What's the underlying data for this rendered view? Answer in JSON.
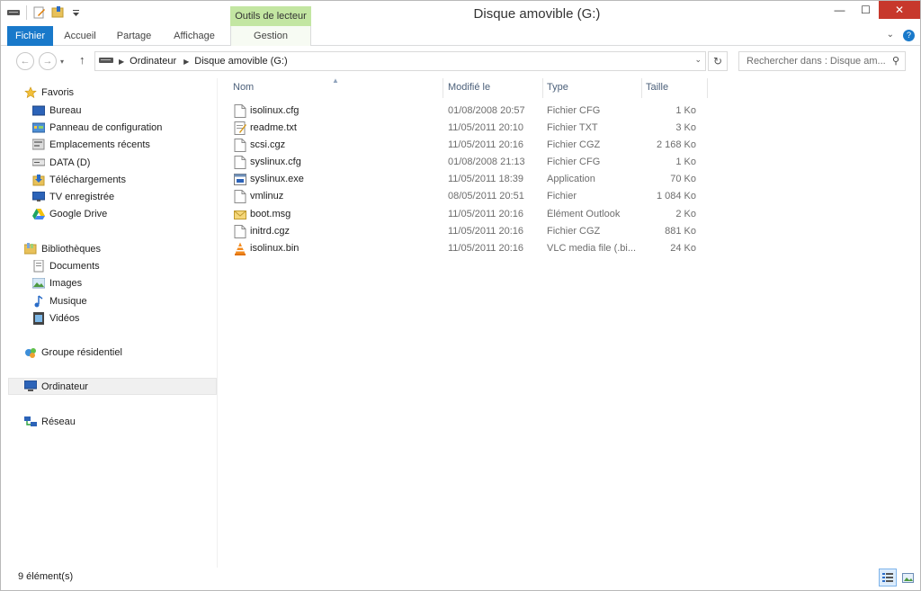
{
  "window": {
    "title": "Disque amovible (G:)",
    "contextual_tab": "Outils de lecteur",
    "controls": {
      "minimize": "—",
      "maximize": "☐",
      "close": "✕"
    }
  },
  "ribbon": {
    "tabs": [
      {
        "label": "Fichier"
      },
      {
        "label": "Accueil"
      },
      {
        "label": "Partage"
      },
      {
        "label": "Affichage"
      },
      {
        "label": "Gestion"
      }
    ],
    "expand_glyph": "⌄",
    "help_glyph": "?"
  },
  "address": {
    "segments": [
      "Ordinateur",
      "Disque amovible (G:)"
    ],
    "search_placeholder": "Rechercher dans : Disque am..."
  },
  "navpane": {
    "favorites": {
      "label": "Favoris",
      "items": [
        "Bureau",
        "Panneau de configuration",
        "Emplacements récents",
        "DATA (D)",
        "Téléchargements",
        "TV enregistrée",
        "Google Drive"
      ]
    },
    "libraries": {
      "label": "Bibliothèques",
      "items": [
        "Documents",
        "Images",
        "Musique",
        "Vidéos"
      ]
    },
    "homegroup": "Groupe résidentiel",
    "computer": "Ordinateur",
    "network": "Réseau"
  },
  "columns": {
    "name": "Nom",
    "modified": "Modifié le",
    "type": "Type",
    "size": "Taille"
  },
  "files": [
    {
      "name": "isolinux.cfg",
      "modified": "01/08/2008 20:57",
      "type": "Fichier CFG",
      "size": "1 Ko",
      "icon": "file-icon"
    },
    {
      "name": "readme.txt",
      "modified": "11/05/2011 20:10",
      "type": "Fichier TXT",
      "size": "3 Ko",
      "icon": "text-file-icon"
    },
    {
      "name": "scsi.cgz",
      "modified": "11/05/2011 20:16",
      "type": "Fichier CGZ",
      "size": "2 168 Ko",
      "icon": "file-icon"
    },
    {
      "name": "syslinux.cfg",
      "modified": "01/08/2008 21:13",
      "type": "Fichier CFG",
      "size": "1 Ko",
      "icon": "file-icon"
    },
    {
      "name": "syslinux.exe",
      "modified": "11/05/2011 18:39",
      "type": "Application",
      "size": "70 Ko",
      "icon": "exe-icon"
    },
    {
      "name": "vmlinuz",
      "modified": "08/05/2011 20:51",
      "type": "Fichier",
      "size": "1 084 Ko",
      "icon": "file-icon"
    },
    {
      "name": "boot.msg",
      "modified": "11/05/2011 20:16",
      "type": "Élément Outlook",
      "size": "2 Ko",
      "icon": "mail-icon"
    },
    {
      "name": "initrd.cgz",
      "modified": "11/05/2011 20:16",
      "type": "Fichier CGZ",
      "size": "881 Ko",
      "icon": "file-icon"
    },
    {
      "name": "isolinux.bin",
      "modified": "11/05/2011 20:16",
      "type": "VLC media file (.bi...",
      "size": "24 Ko",
      "icon": "vlc-icon"
    }
  ],
  "status": {
    "count": "9 élément(s)"
  }
}
